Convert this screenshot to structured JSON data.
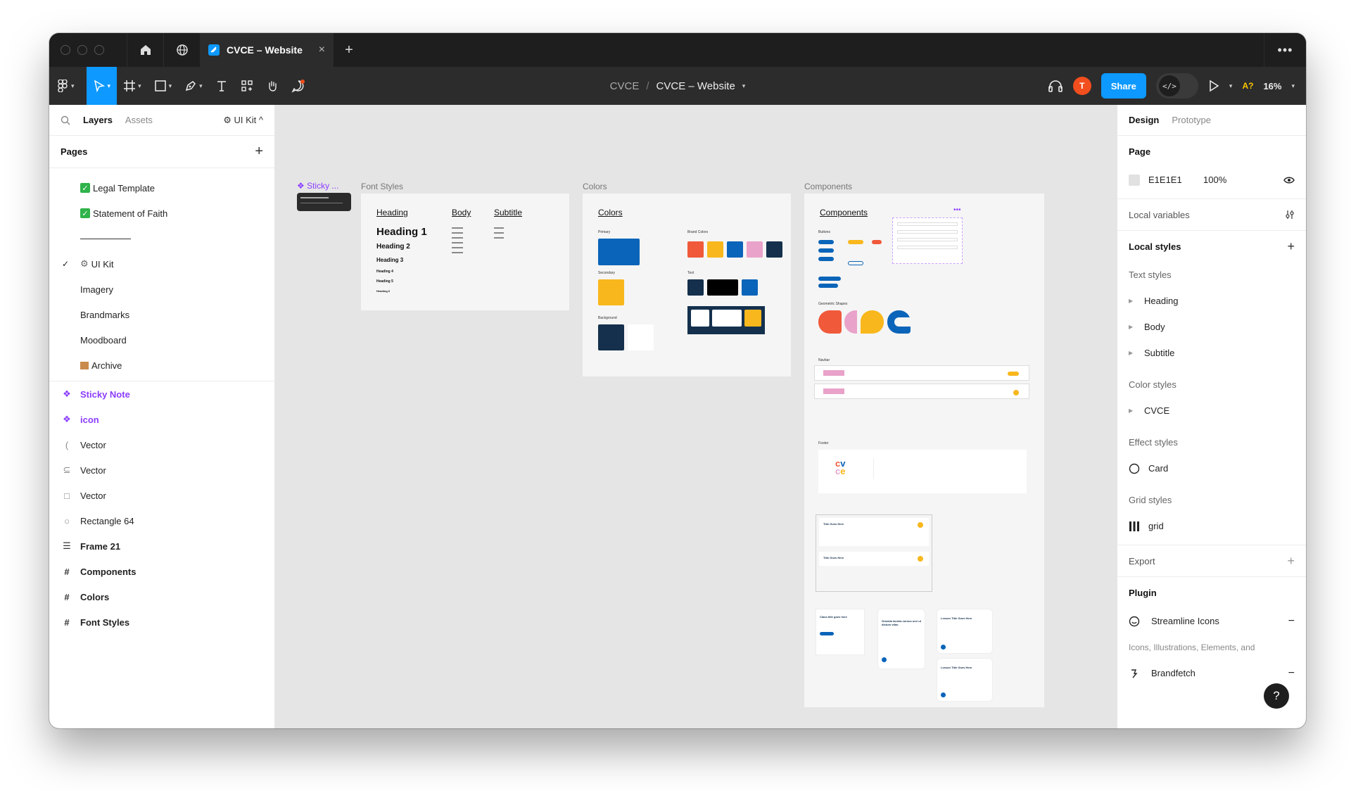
{
  "tabbar": {
    "tab_title": "CVCE – Website",
    "close_glyph": "×",
    "plus_glyph": "+",
    "more_glyph": "•••"
  },
  "toolbar": {
    "project": "CVCE",
    "separator": "/",
    "file_title": "CVCE – Website",
    "avatar_letter": "T",
    "share_label": "Share",
    "devmode_glyph": "</>",
    "a11y_label": "A?",
    "zoom_label": "16%"
  },
  "left_panel": {
    "tab_layers": "Layers",
    "tab_assets": "Assets",
    "kit_label": "⚙ UI Kit ^",
    "pages_header": "Pages",
    "pages": [
      {
        "label": "Legal Template"
      },
      {
        "label": "Statement of Faith"
      },
      {
        "label": "UI Kit"
      },
      {
        "label": "Imagery"
      },
      {
        "label": "Brandmarks"
      },
      {
        "label": "Moodboard"
      },
      {
        "label": "Archive"
      }
    ],
    "current_check": "✓",
    "layers": [
      {
        "label": "Sticky Note"
      },
      {
        "label": "icon"
      },
      {
        "label": "Vector"
      },
      {
        "label": "Vector"
      },
      {
        "label": "Vector"
      },
      {
        "label": "Rectangle 64"
      },
      {
        "label": "Frame 21"
      },
      {
        "label": "Components"
      },
      {
        "label": "Colors"
      },
      {
        "label": "Font Styles"
      }
    ]
  },
  "canvas": {
    "labels": {
      "sticky": "Sticky ...",
      "font_styles": "Font Styles",
      "colors": "Colors",
      "components": "Components"
    },
    "font_frame": {
      "heading": "Heading",
      "body": "Body",
      "subtitle": "Subtitle",
      "h1": "Heading 1",
      "h2": "Heading 2",
      "h3": "Heading 3",
      "h4": "Heading 4",
      "h5": "Heading 5",
      "h6": "Heading 6"
    },
    "colors_frame": {
      "title": "Colors",
      "primary": "Primary",
      "secondary": "Secondary",
      "background": "Background",
      "brand": "Brand Colors",
      "text": "Text"
    },
    "components_frame": {
      "title": "Components",
      "buttons": "Buttons",
      "shapes": "Geometric Shapes",
      "navbar": "Navbar",
      "footer": "Footer",
      "card_title": "Title Goes Here",
      "class_title": "Class title goes here",
      "lesson_title": "Lesson Title Goes Here",
      "gravida": "Gravida lacinia cursus orci ut dictum vitae."
    },
    "colors": {
      "blue": "#0a64b9",
      "yellow": "#f8b71c",
      "navy": "#14304d",
      "orange": "#f0593a",
      "pink": "#e9a2c9",
      "black": "#000000"
    }
  },
  "right_panel": {
    "tab_design": "Design",
    "tab_prototype": "Prototype",
    "page_header": "Page",
    "page_color": "E1E1E1",
    "page_opacity": "100%",
    "local_variables": "Local variables",
    "local_styles": "Local styles",
    "text_styles": "Text styles",
    "text_style_items": [
      "Heading",
      "Body",
      "Subtitle"
    ],
    "color_styles": "Color styles",
    "color_style_items": [
      "CVCE"
    ],
    "effect_styles": "Effect styles",
    "effect_item": "Card",
    "grid_styles": "Grid styles",
    "grid_item": "grid",
    "export": "Export",
    "plugin": "Plugin",
    "plugin_streamline": "Streamline Icons",
    "plugin_streamline_desc": "Icons, Illustrations, Elements, and",
    "plugin_brandfetch": "Brandfetch",
    "help_glyph": "?"
  }
}
